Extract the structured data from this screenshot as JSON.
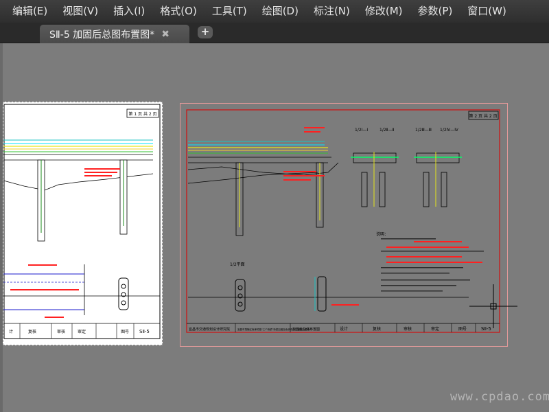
{
  "menu": [
    "编辑(E)",
    "视图(V)",
    "插入(I)",
    "格式(O)",
    "工具(T)",
    "绘图(D)",
    "标注(N)",
    "修改(M)",
    "参数(P)",
    "窗口(W)"
  ],
  "tab": {
    "title": "SⅡ-5 加固后总图布置图*",
    "close_glyph": "✖"
  },
  "newtab_glyph": "+",
  "sheet_left": {
    "page_label": "第 1 页  共 2 页",
    "title_block": [
      "计",
      "复核",
      "审核",
      "审定",
      "图号",
      "SⅡ-5"
    ]
  },
  "sheet_right": {
    "page_label": "第 2 页  共 2 页",
    "section_labels": [
      "1/2Ⅰ—Ⅰ",
      "1/2Ⅱ—Ⅱ",
      "1/2Ⅲ—Ⅲ",
      "1/2Ⅳ—Ⅳ"
    ],
    "detail_label": "1/2平面",
    "notes_title": "说明：",
    "title_block": [
      "宜昌市交通规划设计研究院",
      "宜昌市夷陵区南津关路\"三个桥梁\"桥梁加固及危桥改造工程施工图设计",
      "加固后总体布置图",
      "设计",
      "复核",
      "审核",
      "审定",
      "图号",
      "SⅡ-5"
    ]
  },
  "watermark": "www.cpdao.com"
}
